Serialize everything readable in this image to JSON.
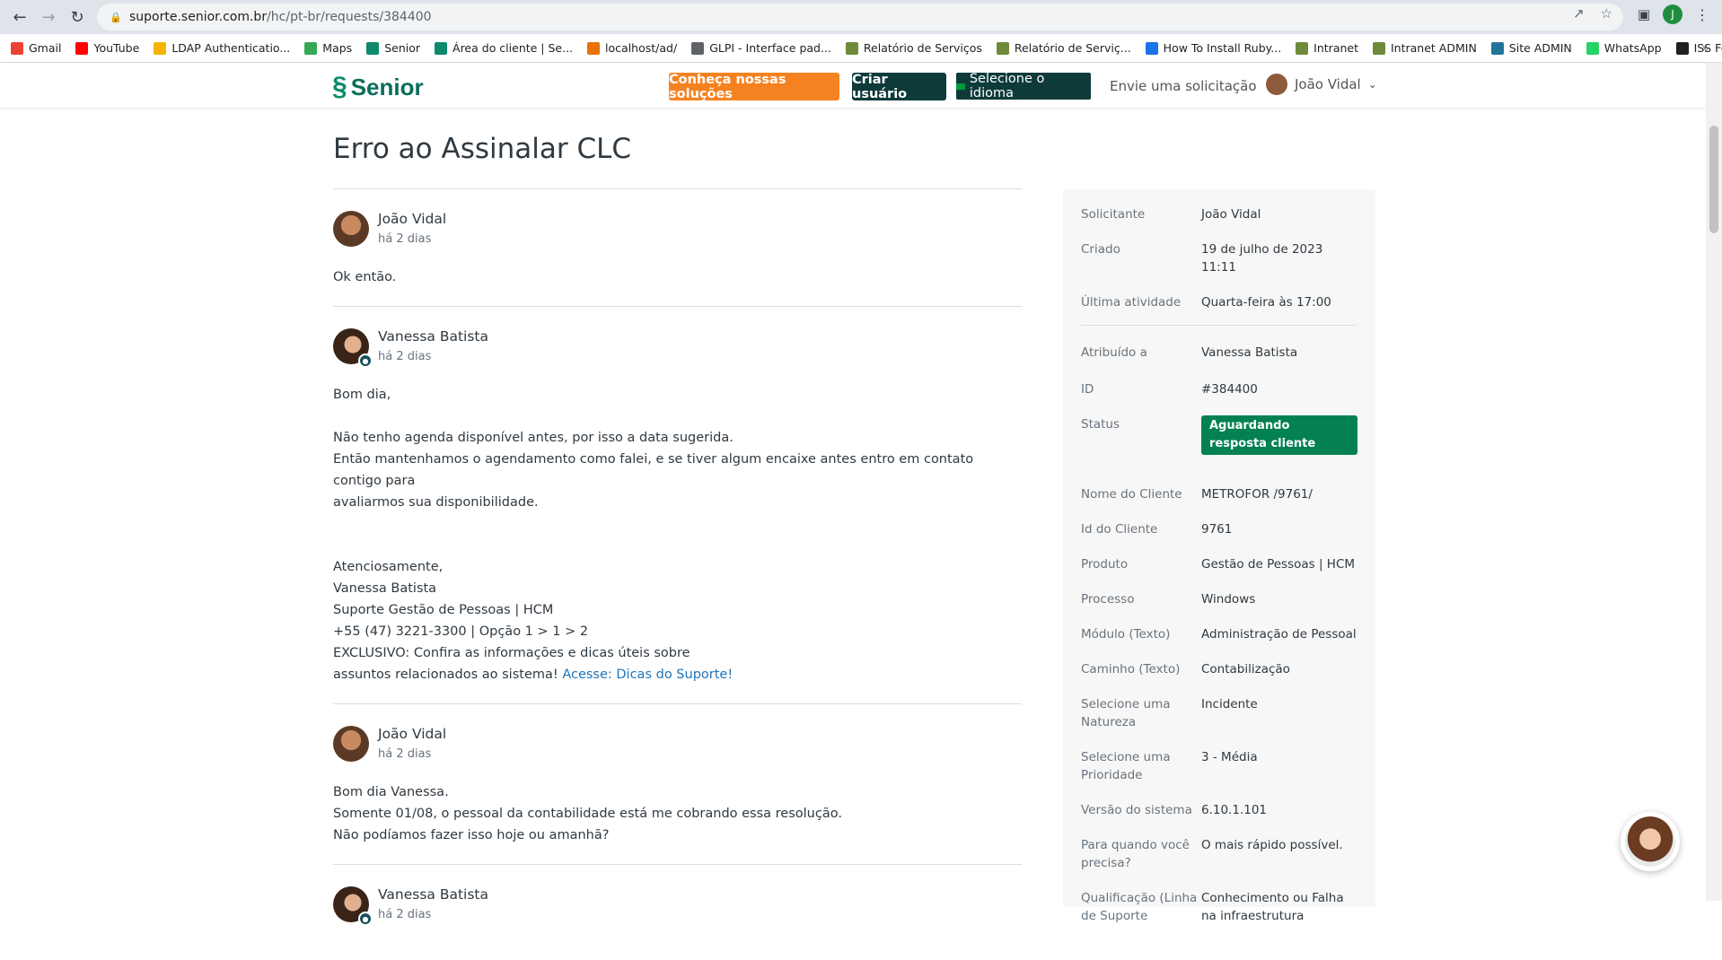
{
  "browser": {
    "url_host": "suporte.senior.com.br",
    "url_path": "/hc/pt-br/requests/384400",
    "profile_initial": "J",
    "bookmarks": [
      {
        "label": "Gmail",
        "icon": "gmail-icon",
        "color": "#ea4335"
      },
      {
        "label": "YouTube",
        "icon": "youtube-icon",
        "color": "#ff0000"
      },
      {
        "label": "LDAP Authenticatio...",
        "icon": "folder-icon",
        "color": "#f4b400"
      },
      {
        "label": "Maps",
        "icon": "maps-icon",
        "color": "#34a853"
      },
      {
        "label": "Senior",
        "icon": "senior-icon",
        "color": "#0c8a6b"
      },
      {
        "label": "Área do cliente | Se...",
        "icon": "senior-icon",
        "color": "#0c8a6b"
      },
      {
        "label": "localhost/ad/",
        "icon": "localhost-icon",
        "color": "#e8710a"
      },
      {
        "label": "GLPI - Interface pad...",
        "icon": "glpi-icon",
        "color": "#5f6368"
      },
      {
        "label": "Relatório de Serviços",
        "icon": "report-icon",
        "color": "#6d8b3a"
      },
      {
        "label": "Relatório de Serviç...",
        "icon": "report-icon",
        "color": "#6d8b3a"
      },
      {
        "label": "How To Install Ruby...",
        "icon": "ruby-icon",
        "color": "#1a73e8"
      },
      {
        "label": "Intranet",
        "icon": "intranet-icon",
        "color": "#6d8b3a"
      },
      {
        "label": "Intranet ADMIN",
        "icon": "intranet-icon",
        "color": "#6d8b3a"
      },
      {
        "label": "Site ADMIN",
        "icon": "wordpress-icon",
        "color": "#21759b"
      },
      {
        "label": "WhatsApp",
        "icon": "whatsapp-icon",
        "color": "#25d366"
      },
      {
        "label": "ISS Fortaleza",
        "icon": "iss-icon",
        "color": "#202124"
      }
    ],
    "bookmarks_more": "»"
  },
  "header": {
    "logo": "Senior",
    "cta_label": "Conheça nossas soluções",
    "create_user_label": "Criar usuário",
    "language_label": "Selecione o idioma",
    "submit_request_label": "Envie uma solicitação",
    "user_name": "João Vidal"
  },
  "request": {
    "title": "Erro ao Assinalar CLC"
  },
  "comments": [
    {
      "author": "João Vidal",
      "time": "há 2 dias",
      "lines": [
        "Ok então."
      ]
    },
    {
      "author": "Vanessa Batista",
      "time": "há 2 dias",
      "lines": [
        "Bom dia,",
        "",
        "Não tenho agenda disponível antes, por isso a data sugerida.",
        "Então mantenhamos o agendamento como falei, e se tiver algum encaixe antes entro em contato contigo para",
        "avaliarmos sua disponibilidade.",
        "",
        "",
        "Atenciosamente,",
        "Vanessa Batista",
        "Suporte Gestão de Pessoas | HCM",
        "+55 (47) 3221-3300 | Opção 1 > 1 > 2",
        "EXCLUSIVO: Confira as informações e dicas úteis sobre",
        "assuntos relacionados ao sistema!"
      ],
      "link": "Acesse: Dicas do Suporte!"
    },
    {
      "author": "João Vidal",
      "time": "há 2 dias",
      "lines": [
        "Bom dia Vanessa.",
        "Somente 01/08, o pessoal da contabilidade está me cobrando essa resolução.",
        "Não podíamos fazer isso hoje ou amanhã?"
      ]
    },
    {
      "author": "Vanessa Batista",
      "time": "há 2 dias",
      "lines": []
    }
  ],
  "details": {
    "requester_label": "Solicitante",
    "requester": "João Vidal",
    "created_label": "Criado",
    "created": "19 de julho de 2023 11:11",
    "last_activity_label": "Última atividade",
    "last_activity": "Quarta-feira às 17:00",
    "assigned_label": "Atribuído a",
    "assigned": "Vanessa Batista",
    "id_label": "ID",
    "id": "#384400",
    "status_label": "Status",
    "status": "Aguardando resposta cliente",
    "client_name_label": "Nome do Cliente",
    "client_name": "METROFOR /9761/",
    "client_id_label": "Id do Cliente",
    "client_id": "9761",
    "product_label": "Produto",
    "product": "Gestão de Pessoas | HCM",
    "process_label": "Processo",
    "process": "Windows",
    "module_label": "Módulo (Texto)",
    "module": "Administração de Pessoal",
    "path_label": "Caminho (Texto)",
    "path": "Contabilização",
    "nature_label": "Selecione uma Natureza",
    "nature": "Incidente",
    "priority_label": "Selecione uma Prioridade",
    "priority": "3 - Média",
    "version_label": "Versão do sistema",
    "version": "6.10.1.101",
    "when_label": "Para quando você precisa?",
    "when": "O mais rápido possível.",
    "qualification_label": "Qualificação (Linha de Suporte",
    "qualification": "Conhecimento ou Falha na infraestrutura"
  },
  "colors": {
    "accent_orange": "#f58220",
    "dark_teal": "#0f3a3a",
    "status_green": "#038153",
    "link_blue": "#1f73b7"
  }
}
